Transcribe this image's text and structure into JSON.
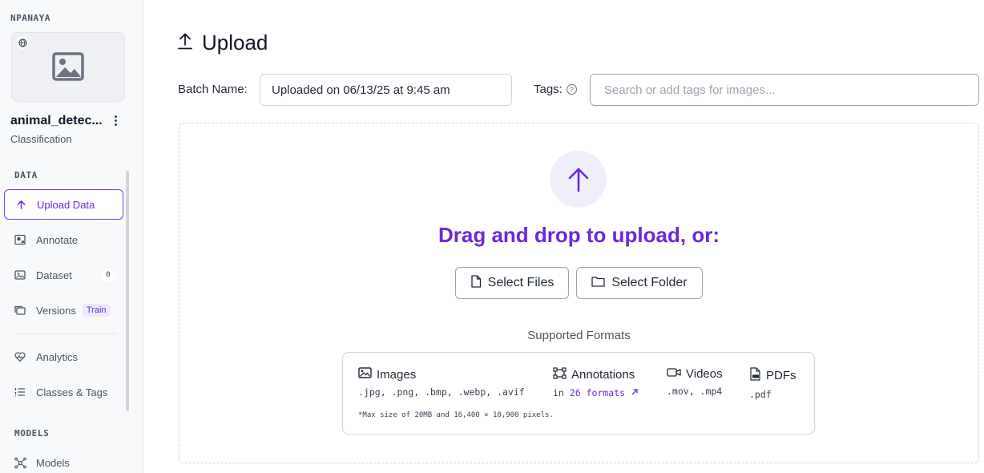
{
  "sidebar": {
    "workspace": "NPANAYA",
    "project_name": "animal_detec...",
    "project_type": "Classification",
    "data_section": "DATA",
    "models_section": "MODELS",
    "items": [
      {
        "label": "Upload Data",
        "icon": "upload-arrow-icon"
      },
      {
        "label": "Annotate",
        "icon": "annotate-icon"
      },
      {
        "label": "Dataset",
        "icon": "dataset-icon",
        "count": "0"
      },
      {
        "label": "Versions",
        "icon": "versions-icon",
        "badge": "Train"
      },
      {
        "label": "Analytics",
        "icon": "analytics-icon"
      },
      {
        "label": "Classes & Tags",
        "icon": "list-icon"
      },
      {
        "label": "Models",
        "icon": "models-icon"
      }
    ]
  },
  "header": {
    "title": "Upload"
  },
  "batch": {
    "label": "Batch Name:",
    "value": "Uploaded on 06/13/25 at 9:45 am"
  },
  "tags": {
    "label": "Tags:",
    "placeholder": "Search or add tags for images..."
  },
  "dropzone": {
    "headline": "Drag and drop to upload, or:",
    "select_files": "Select Files",
    "select_folder": "Select Folder",
    "formats_label": "Supported Formats",
    "formats": [
      {
        "name": "Images",
        "detail": ".jpg, .png, .bmp, .webp, .avif"
      },
      {
        "name": "Annotations",
        "detail_prefix": "in",
        "detail_link": "26 formats"
      },
      {
        "name": "Videos",
        "detail": ".mov, .mp4"
      },
      {
        "name": "PDFs",
        "detail": ".pdf"
      }
    ],
    "max_note": "*Max size of 20MB and 16,400 × 10,900 pixels."
  },
  "colors": {
    "accent": "#6d28d9",
    "accent_light": "#f1eefb"
  }
}
